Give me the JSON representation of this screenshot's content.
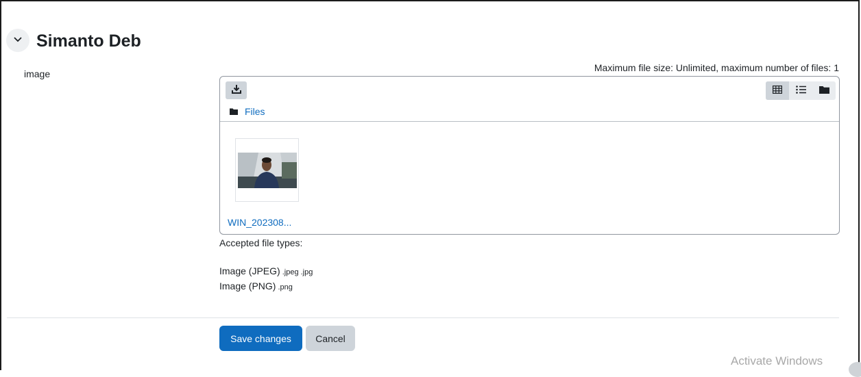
{
  "section": {
    "title": "Simanto Deb",
    "collapse_icon": "chevron-down-icon"
  },
  "field": {
    "label": "image",
    "max_info": "Maximum file size: Unlimited, maximum number of files: 1"
  },
  "filemanager": {
    "toolbar": {
      "download_icon": "download-icon",
      "views": [
        "grid-view-icon",
        "list-view-icon",
        "folder-view-icon"
      ],
      "active_view": "grid-view-icon"
    },
    "path": {
      "folder_icon": "folder-icon",
      "label": "Files"
    },
    "files": [
      {
        "name": "WIN_202308..."
      }
    ]
  },
  "accepted": {
    "title": "Accepted file types:",
    "types": [
      {
        "name": "Image (JPEG)",
        "ext": ".jpeg .jpg"
      },
      {
        "name": "Image (PNG)",
        "ext": ".png"
      }
    ]
  },
  "actions": {
    "save_label": "Save changes",
    "cancel_label": "Cancel"
  },
  "watermark": "Activate Windows",
  "colors": {
    "primary": "#0f6cbf",
    "secondary": "#ced4da"
  }
}
